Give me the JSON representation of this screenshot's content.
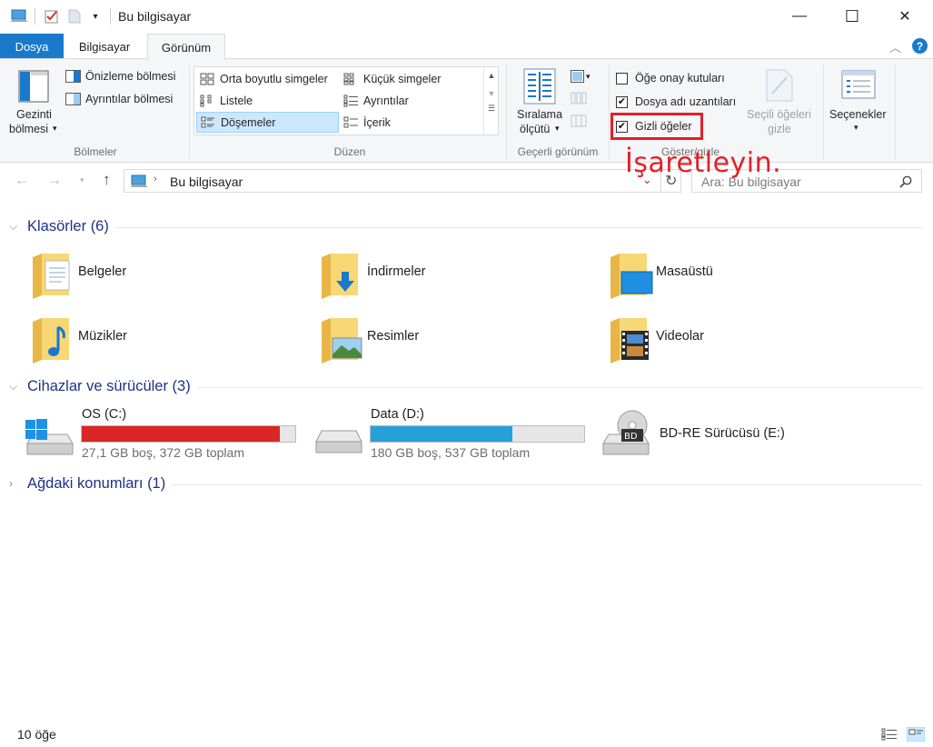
{
  "window": {
    "title": "Bu bilgisayar",
    "controls": {
      "minimize": "—",
      "maximize": "☐",
      "close": "✕"
    }
  },
  "tabs": [
    {
      "label": "Dosya",
      "active": false
    },
    {
      "label": "Bilgisayar",
      "active": false
    },
    {
      "label": "Görünüm",
      "active": true
    }
  ],
  "ribbon": {
    "panes": {
      "navigation_label_1": "Gezinti",
      "navigation_label_2": "bölmesi",
      "preview": "Önizleme bölmesi",
      "details": "Ayrıntılar bölmesi",
      "group": "Bölmeler"
    },
    "layout": {
      "items": [
        {
          "label": "Orta boyutlu simgeler",
          "selected": false
        },
        {
          "label": "Küçük simgeler",
          "selected": false
        },
        {
          "label": "Listele",
          "selected": false
        },
        {
          "label": "Ayrıntılar",
          "selected": false
        },
        {
          "label": "Döşemeler",
          "selected": true
        },
        {
          "label": "İçerik",
          "selected": false
        }
      ],
      "group": "Düzen"
    },
    "current_view": {
      "sort_1": "Sıralama",
      "sort_2": "ölçütü",
      "group": "Geçerli görünüm"
    },
    "show_hide": {
      "item_checkboxes": {
        "label": "Öğe onay kutuları",
        "checked": false
      },
      "file_extensions": {
        "label": "Dosya adı uzantıları",
        "checked": true
      },
      "hidden_items": {
        "label": "Gizli öğeler",
        "checked": true
      },
      "hide_selected_1": "Seçili öğeleri",
      "hide_selected_2": "gizle",
      "group": "Göster/gizle"
    },
    "options": {
      "label": "Seçenekler"
    }
  },
  "address": {
    "path": "Bu bilgisayar",
    "search_placeholder": "Ara: Bu bilgisayar"
  },
  "sections": {
    "folders": {
      "title": "Klasörler (6)",
      "items": [
        "Belgeler",
        "İndirmeler",
        "Masaüstü",
        "Müzikler",
        "Resimler",
        "Videolar"
      ]
    },
    "devices": {
      "title": "Cihazlar ve sürücüler (3)",
      "drives": [
        {
          "name": "OS (C:)",
          "info": "27,1 GB boş, 372 GB toplam",
          "used_fraction": 0.927,
          "color": "#da2626"
        },
        {
          "name": "Data (D:)",
          "info": "180 GB boş, 537 GB toplam",
          "used_fraction": 0.665,
          "color": "#26a0da"
        },
        {
          "name": "BD-RE Sürücüsü (E:)"
        }
      ]
    },
    "network": {
      "title": "Ağdaki konumları (1)"
    }
  },
  "status": {
    "count": "10 öğe"
  },
  "annotation": {
    "text": "İşaretleyin."
  }
}
